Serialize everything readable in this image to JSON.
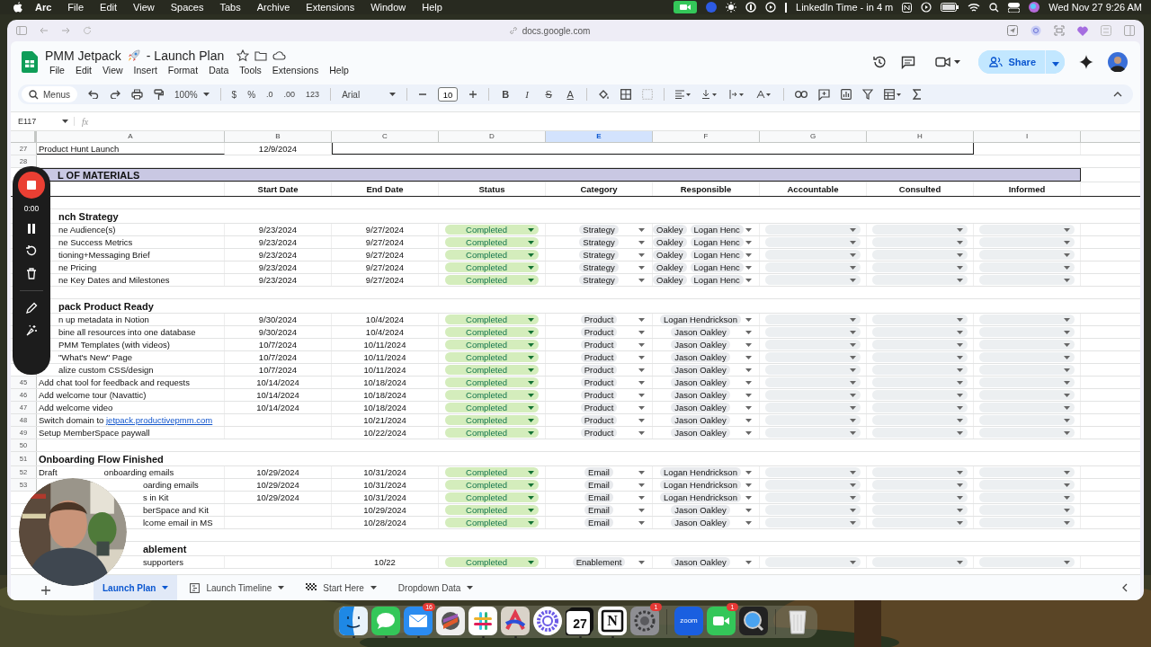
{
  "menubar": {
    "app": "Arc",
    "menus": [
      "File",
      "Edit",
      "View",
      "Spaces",
      "Tabs",
      "Archive",
      "Extensions",
      "Window",
      "Help"
    ],
    "event": "LinkedIn Time - in 4 m",
    "clock": "Wed Nov 27  9:26 AM"
  },
  "browser": {
    "url": "docs.google.com"
  },
  "doc": {
    "title": "PMM Jetpack",
    "title_tail": "- Launch Plan",
    "menus": [
      "File",
      "Edit",
      "View",
      "Insert",
      "Format",
      "Data",
      "Tools",
      "Extensions",
      "Help"
    ],
    "share": "Share"
  },
  "toolbar": {
    "search": "Menus",
    "zoom": "100%",
    "currency": "$",
    "percent": "%",
    "dec_less": ".0",
    "dec_more": ".00",
    "number_format": "123",
    "font": "Arial",
    "size": "10",
    "format_buttons": [
      "B",
      "I",
      "S",
      "A"
    ]
  },
  "formula_bar": {
    "cell": "E117",
    "fx": "fx"
  },
  "recorder": {
    "timer": "0:00"
  },
  "sheet": {
    "columns": [
      {
        "label": "A",
        "selected": false
      },
      {
        "label": "B",
        "selected": false
      },
      {
        "label": "C",
        "selected": false
      },
      {
        "label": "D",
        "selected": false
      },
      {
        "label": "E",
        "selected": true
      },
      {
        "label": "F",
        "selected": false
      },
      {
        "label": "G",
        "selected": false
      },
      {
        "label": "H",
        "selected": false
      },
      {
        "label": "I",
        "selected": false
      }
    ],
    "rows": [
      {
        "kind": "milestone",
        "num": "27",
        "a": "Product Hunt Launch",
        "b": "12/9/2024"
      },
      {
        "kind": "blank",
        "num": "28"
      },
      {
        "kind": "banner",
        "a": "L OF MATERIALS"
      },
      {
        "kind": "header",
        "headers": [
          "Start Date",
          "End Date",
          "Status",
          "Category",
          "Responsible",
          "Accountable",
          "Consulted",
          "Informed"
        ]
      },
      {
        "kind": "blank"
      },
      {
        "kind": "section",
        "a": "nch Strategy"
      },
      {
        "kind": "task",
        "a": "ne Audience(s)",
        "b": "9/23/2024",
        "c": "9/27/2024",
        "status": "Completed",
        "category": "Strategy",
        "responsible": [
          "Oakley",
          "Logan Henc"
        ]
      },
      {
        "kind": "task",
        "a": "ne Success Metrics",
        "b": "9/23/2024",
        "c": "9/27/2024",
        "status": "Completed",
        "category": "Strategy",
        "responsible": [
          "Oakley",
          "Logan Henc"
        ]
      },
      {
        "kind": "task",
        "a": "tioning+Messaging Brief",
        "b": "9/23/2024",
        "c": "9/27/2024",
        "status": "Completed",
        "category": "Strategy",
        "responsible": [
          "Oakley",
          "Logan Henc"
        ]
      },
      {
        "kind": "task",
        "a": "ne Pricing",
        "b": "9/23/2024",
        "c": "9/27/2024",
        "status": "Completed",
        "category": "Strategy",
        "responsible": [
          "Oakley",
          "Logan Henc"
        ]
      },
      {
        "kind": "task",
        "a": "ne Key Dates and Milestones",
        "b": "9/23/2024",
        "c": "9/27/2024",
        "status": "Completed",
        "category": "Strategy",
        "responsible": [
          "Oakley",
          "Logan Henc"
        ]
      },
      {
        "kind": "blank"
      },
      {
        "kind": "section",
        "a": "pack Product Ready"
      },
      {
        "kind": "task",
        "a": "n up metadata in Notion",
        "b": "9/30/2024",
        "c": "10/4/2024",
        "status": "Completed",
        "category": "Product",
        "responsible": [
          "Logan Hendrickson"
        ]
      },
      {
        "kind": "task",
        "a": "bine all resources into one database",
        "b": "9/30/2024",
        "c": "10/4/2024",
        "status": "Completed",
        "category": "Product",
        "responsible": [
          "Jason Oakley"
        ]
      },
      {
        "kind": "task",
        "a": "PMM Templates (with videos)",
        "b": "10/7/2024",
        "c": "10/11/2024",
        "status": "Completed",
        "category": "Product",
        "responsible": [
          "Jason Oakley"
        ]
      },
      {
        "kind": "task",
        "a": "\"What's New\" Page",
        "b": "10/7/2024",
        "c": "10/11/2024",
        "status": "Completed",
        "category": "Product",
        "responsible": [
          "Jason Oakley"
        ]
      },
      {
        "kind": "task",
        "a": "alize custom CSS/design",
        "b": "10/7/2024",
        "c": "10/11/2024",
        "status": "Completed",
        "category": "Product",
        "responsible": [
          "Jason Oakley"
        ]
      },
      {
        "kind": "task",
        "num": "45",
        "a": "Add chat tool for feedback and requests",
        "b": "10/14/2024",
        "c": "10/18/2024",
        "status": "Completed",
        "category": "Product",
        "responsible": [
          "Jason Oakley"
        ]
      },
      {
        "kind": "task",
        "num": "46",
        "a": "Add welcome tour (Navattic)",
        "b": "10/14/2024",
        "c": "10/18/2024",
        "status": "Completed",
        "category": "Product",
        "responsible": [
          "Jason Oakley"
        ]
      },
      {
        "kind": "task",
        "num": "47",
        "a": "Add welcome video",
        "b": "10/14/2024",
        "c": "10/18/2024",
        "status": "Completed",
        "category": "Product",
        "responsible": [
          "Jason Oakley"
        ]
      },
      {
        "kind": "task",
        "num": "48",
        "a": "Switch domain to",
        "link": "jetpack.productivepmm.com",
        "c": "10/21/2024",
        "status": "Completed",
        "category": "Product",
        "responsible": [
          "Jason Oakley"
        ]
      },
      {
        "kind": "task",
        "num": "49",
        "a": "Setup MemberSpace paywall",
        "c": "10/22/2024",
        "status": "Completed",
        "category": "Product",
        "responsible": [
          "Jason Oakley"
        ]
      },
      {
        "kind": "blank",
        "num": "50"
      },
      {
        "kind": "section",
        "num": "51",
        "a": "Onboarding Flow Finished"
      },
      {
        "kind": "task",
        "num": "52",
        "a": "Draft",
        "a_tail": "onboarding emails",
        "b": "10/29/2024",
        "c": "10/31/2024",
        "status": "Completed",
        "category": "Email",
        "responsible": [
          "Logan Hendrickson"
        ]
      },
      {
        "kind": "task",
        "num": "53",
        "a": "oarding emails",
        "b": "10/29/2024",
        "c": "10/31/2024",
        "status": "Completed",
        "category": "Email",
        "responsible": [
          "Logan Hendrickson"
        ]
      },
      {
        "kind": "task",
        "a": "s in Kit",
        "b": "10/29/2024",
        "c": "10/31/2024",
        "status": "Completed",
        "category": "Email",
        "responsible": [
          "Logan Hendrickson"
        ]
      },
      {
        "kind": "task",
        "a": "berSpace and Kit",
        "c": "10/29/2024",
        "status": "Completed",
        "category": "Email",
        "responsible": [
          "Jason Oakley"
        ]
      },
      {
        "kind": "task",
        "a": "lcome email in MS",
        "c": "10/28/2024",
        "status": "Completed",
        "category": "Email",
        "responsible": [
          "Jason Oakley"
        ]
      },
      {
        "kind": "blank"
      },
      {
        "kind": "section",
        "a": "ablement"
      },
      {
        "kind": "task",
        "a": "supporters",
        "c": "10/22",
        "status": "Completed",
        "category": "Enablement",
        "responsible": [
          "Jason Oakley"
        ]
      }
    ]
  },
  "sheet_tabs": [
    {
      "label": "Launch Plan",
      "selected": true,
      "kind": "plain"
    },
    {
      "label": "Launch Timeline",
      "selected": false,
      "kind": "timeline"
    },
    {
      "label": "Start Here",
      "selected": false,
      "kind": "flag"
    },
    {
      "label": "Dropdown Data",
      "selected": false,
      "kind": "plain"
    }
  ],
  "dock": [
    {
      "kind": "finder",
      "running": true
    },
    {
      "kind": "messages",
      "running": true
    },
    {
      "kind": "mail",
      "badge": "16",
      "running": true
    },
    {
      "kind": "palette",
      "running": false
    },
    {
      "kind": "slack",
      "running": true
    },
    {
      "kind": "arc",
      "running": true
    },
    {
      "kind": "flower",
      "running": false
    },
    {
      "kind": "calendar",
      "glyph": "27",
      "running": true
    },
    {
      "kind": "notion",
      "glyph": "N",
      "running": true
    },
    {
      "kind": "settings",
      "badge": "1",
      "running": false
    },
    {
      "kind": "divider"
    },
    {
      "kind": "zoom",
      "glyph": "zoom",
      "running": true
    },
    {
      "kind": "facetime",
      "badge": "1",
      "running": false
    },
    {
      "kind": "quicktime",
      "running": false
    },
    {
      "kind": "divider"
    },
    {
      "kind": "trash",
      "running": false
    }
  ]
}
